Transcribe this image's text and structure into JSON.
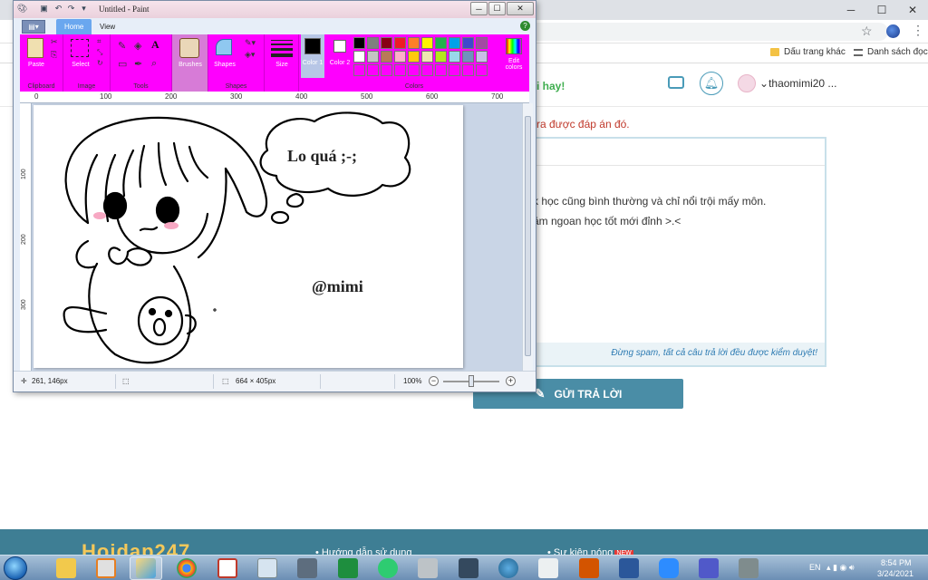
{
  "browser": {
    "bookmarks": [
      "Dấu trang khác",
      "Danh sách đọc"
    ]
  },
  "site": {
    "great_text": "i hay!",
    "username": "thaomimi20 ...",
    "alert_text": "ra được đáp án đó.",
    "answer_line1": "k học cũng bình thường và chỉ nổi trội mấy môn.",
    "answer_line2": "ăm ngoan học tốt mới đỉnh >.<",
    "answer_warning": "Đừng spam, tất cả câu trả lời đều được kiểm duyệt!",
    "submit_label": "GỬI TRẢ LỜI",
    "footer_logo": "Hoidap247",
    "footer_link1": "Hướng dẫn sử dụng",
    "footer_link2": "Sự kiện nóng",
    "footer_badge": "NEW"
  },
  "paint": {
    "title": "Untitled - Paint",
    "tabs": [
      "Home",
      "View"
    ],
    "groups": {
      "clipboard": {
        "label": "Clipboard",
        "paste": "Paste"
      },
      "image": {
        "label": "Image",
        "select": "Select"
      },
      "tools": {
        "label": "Tools"
      },
      "brushes": {
        "label": "Brushes"
      },
      "shapes": {
        "label": "Shapes",
        "shapes": "Shapes"
      },
      "size": {
        "label": "Size"
      },
      "colors": {
        "label": "Colors",
        "color1": "Color 1",
        "color2": "Color 2",
        "edit": "Edit colors"
      }
    },
    "palette": [
      "#000000",
      "#7f7f7f",
      "#880015",
      "#ed1c24",
      "#ff7f27",
      "#fff200",
      "#22b14c",
      "#00a2e8",
      "#3f48cc",
      "#a349a4",
      "#ffffff",
      "#c3c3c3",
      "#b97a57",
      "#ffaec9",
      "#ffc90e",
      "#efe4b0",
      "#b5e61d",
      "#99d9ea",
      "#7092be",
      "#c8bfe7",
      "#fe00fe",
      "#fe00fe",
      "#fe00fe",
      "#fe00fe",
      "#fe00fe",
      "#fe00fe",
      "#fe00fe",
      "#fe00fe",
      "#fe00fe",
      "#fe00fe"
    ],
    "ruler_marks": [
      "0",
      "100",
      "200",
      "300",
      "400",
      "500",
      "600",
      "700"
    ],
    "ruler_marks_v": [
      "100",
      "200",
      "300"
    ],
    "canvas": {
      "bubble_text": "Lo quá ;-;",
      "signature": "@mimi"
    },
    "status": {
      "cursor_pos": "261, 146px",
      "image_size": "664 × 405px",
      "zoom": "100%"
    }
  },
  "taskbar": {
    "lang": "EN",
    "time": "8:54 PM",
    "date": "3/24/2021"
  }
}
